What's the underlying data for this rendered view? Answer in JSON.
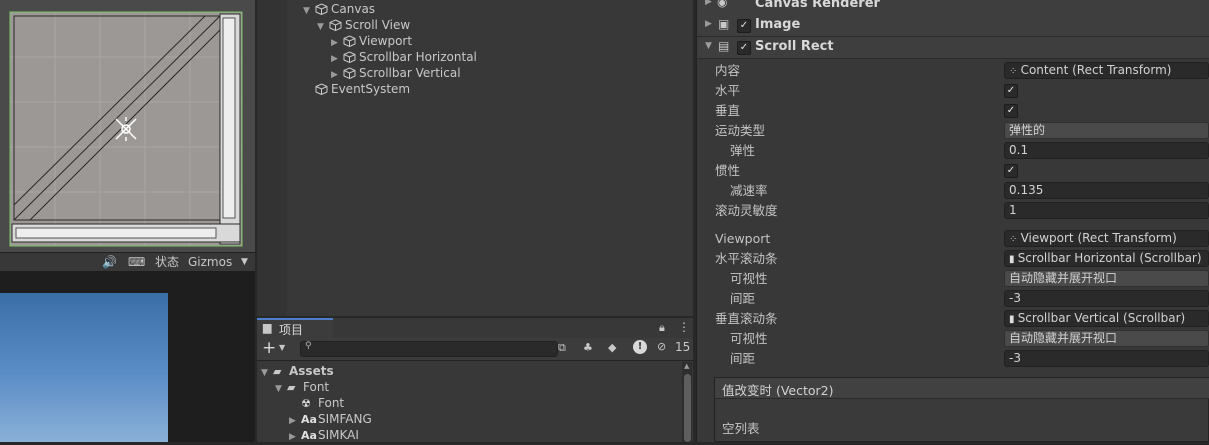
{
  "scene": {
    "toolbar": {
      "menu_icon": "kebab-icon",
      "audio_icon": "speaker-icon",
      "grid_icon": "keyboard-grid-icon",
      "status_label": "状态",
      "gizmos_label": "Gizmos",
      "gizmos_arrow": "chevron-down-icon"
    }
  },
  "hierarchy": {
    "items": [
      {
        "label": "Canvas",
        "arrow": "▼",
        "icon": "cube-icon"
      },
      {
        "label": "Scroll View",
        "arrow": "▼",
        "icon": "cube-icon"
      },
      {
        "label": "Viewport",
        "arrow": "▶",
        "icon": "cube-icon"
      },
      {
        "label": "Scrollbar Horizontal",
        "arrow": "▶",
        "icon": "cube-icon"
      },
      {
        "label": "Scrollbar Vertical",
        "arrow": "▶",
        "icon": "cube-icon"
      },
      {
        "label": "EventSystem",
        "arrow": "",
        "icon": "cube-icon"
      }
    ]
  },
  "project": {
    "tab_label": "项目",
    "add_label": "+",
    "search_placeholder": "",
    "hidden_count": "15",
    "tree": [
      {
        "label": "Assets",
        "arrow": "▼",
        "icon": "folder-open-icon",
        "bold": true
      },
      {
        "label": "Font",
        "arrow": "▼",
        "icon": "folder-open-icon",
        "bold": false
      },
      {
        "label": "Font",
        "arrow": "",
        "icon": "font-asset-icon",
        "bold": false
      },
      {
        "label": "SIMFANG",
        "arrow": "▶",
        "icon": "font-aa-icon",
        "bold": false
      },
      {
        "label": "SIMKAI",
        "arrow": "▶",
        "icon": "font-aa-icon",
        "bold": false
      }
    ],
    "aa": "Aa"
  },
  "inspector": {
    "components": [
      {
        "label": "Canvas Renderer",
        "icon": "eye-icon",
        "checkbox": false
      },
      {
        "label": "Image",
        "icon": "image-icon",
        "checkbox": true
      },
      {
        "label": "Scroll Rect",
        "icon": "scrollrect-icon",
        "checkbox": true
      }
    ],
    "check_mark": "✓",
    "scroll_rect": {
      "content_label": "内容",
      "content_value": "Content (Rect Transform)",
      "horizontal_label": "水平",
      "vertical_label": "垂直",
      "movement_label": "运动类型",
      "movement_value": "弹性的",
      "elasticity_label": "弹性",
      "elasticity_value": "0.1",
      "inertia_label": "惯性",
      "deceleration_label": "减速率",
      "deceleration_value": "0.135",
      "sensitivity_label": "滚动灵敏度",
      "sensitivity_value": "1",
      "viewport_label": "Viewport",
      "viewport_value": "Viewport (Rect Transform)",
      "hscroll_label": "水平滚动条",
      "hscroll_value": "Scrollbar Horizontal (Scrollbar)",
      "hvis_label": "可视性",
      "hvis_value": "自动隐藏并展开视口",
      "hspacing_label": "间距",
      "hspacing_value": "-3",
      "vscroll_label": "垂直滚动条",
      "vscroll_value": "Scrollbar Vertical (Scrollbar)",
      "vvis_label": "可视性",
      "vvis_value": "自动隐藏并展开视口",
      "vspacing_label": "间距",
      "vspacing_value": "-3",
      "event_label": "值改变时 (Vector2)",
      "event_empty": "空列表"
    }
  },
  "colors": {
    "panel": "#383838",
    "accent": "#4c7ec9",
    "selection_green": "#7ec46a"
  }
}
